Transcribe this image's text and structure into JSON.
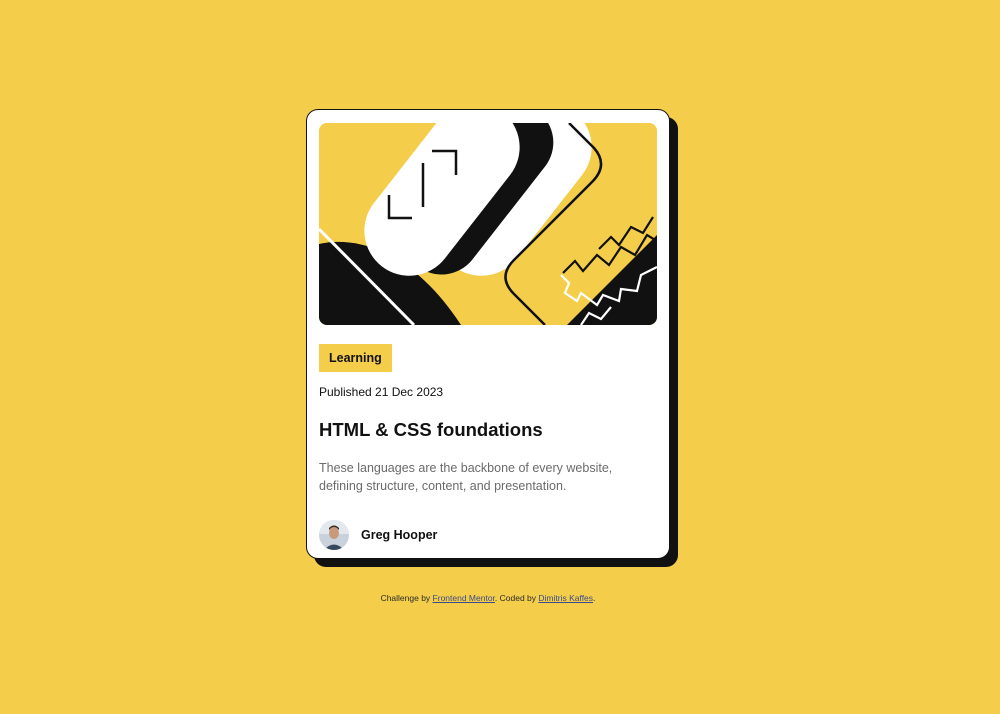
{
  "card": {
    "tag": "Learning",
    "published": "Published 21 Dec 2023",
    "title": "HTML & CSS foundations",
    "description": "These languages are the backbone of every website, defining structure, content, and presentation.",
    "author": {
      "name": "Greg Hooper"
    },
    "illustration_icon": "abstract-illustration"
  },
  "attribution": {
    "prefix": "Challenge by ",
    "challenge_link": "Frontend Mentor",
    "middle": ". Coded by ",
    "coder_link": "Dimitris Kaffes",
    "suffix": "."
  },
  "colors": {
    "background": "#F4CE4A",
    "ink": "#111111",
    "card": "#FFFFFF",
    "muted_text": "#6B6B6B"
  }
}
